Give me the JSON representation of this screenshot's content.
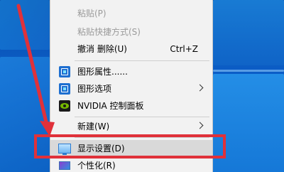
{
  "context_menu": {
    "items": [
      {
        "label": "粘贴(P)",
        "state": "disabled"
      },
      {
        "label": "粘贴快捷方式(S)",
        "state": "disabled"
      },
      {
        "label": "撤消 删除(U)",
        "shortcut": "Ctrl+Z"
      },
      {
        "label": "图形属性......",
        "icon": "intel-graphics-icon"
      },
      {
        "label": "图形选项",
        "icon": "intel-graphics-icon",
        "submenu": true
      },
      {
        "label": "NVIDIA 控制面板",
        "icon": "nvidia-icon"
      },
      {
        "label": "新建(W)",
        "submenu": true
      },
      {
        "label": "显示设置(D)",
        "icon": "display-icon",
        "state": "hover"
      },
      {
        "label": "个性化(R)",
        "icon": "personalize-icon"
      }
    ]
  },
  "annotation": {
    "highlight_color": "#e0313a",
    "arrow_color": "#e0313a",
    "highlighted_item": "显示设置(D)"
  }
}
